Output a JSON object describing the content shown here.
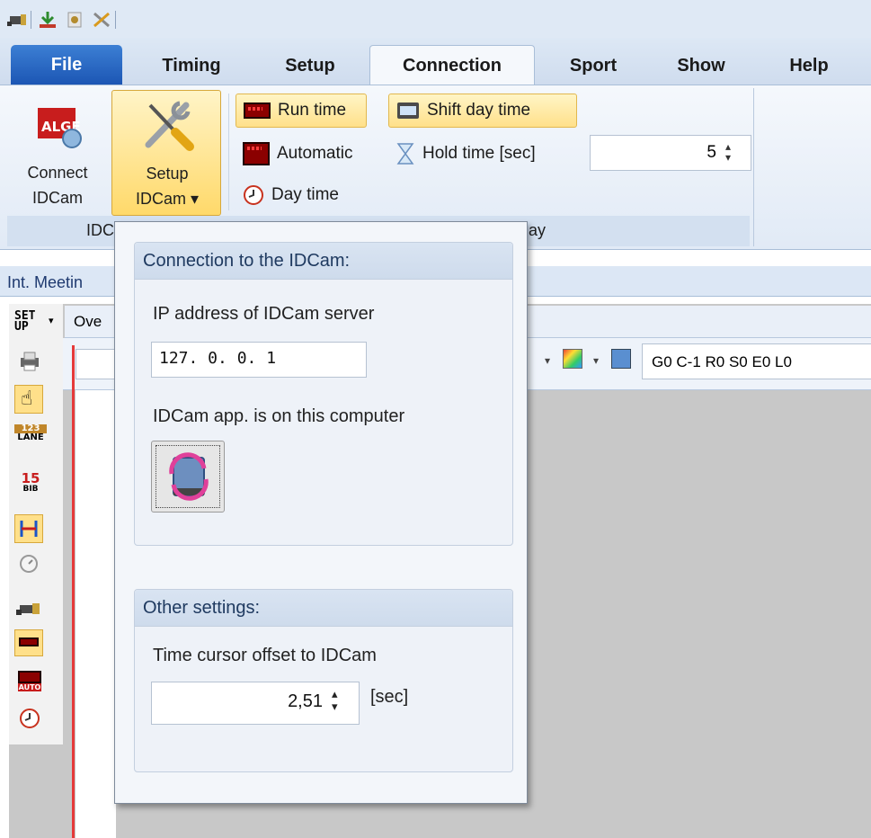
{
  "ribbon_tabs": {
    "file": "File",
    "timing": "Timing",
    "setup": "Setup",
    "connection": "Connection",
    "sport": "Sport",
    "show": "Show",
    "help": "Help"
  },
  "connection_ribbon": {
    "connect_idcam": {
      "line1": "Connect",
      "line2": "IDCam"
    },
    "setup_idcam": {
      "line1": "Setup",
      "line2": "IDCam ▾"
    },
    "run_time": "Run time",
    "automatic": "Automatic",
    "day_time": "Day time",
    "shift_day_time": "Shift day time",
    "hold_time_label": "Hold time [sec]",
    "hold_time_value": "5",
    "group_label_left": "IDC",
    "group_label_right": "ay"
  },
  "workspace": {
    "meeting_tab": "Int. Meetin",
    "setup_tool": "SET UP",
    "overview_tab": "Ove",
    "status_code": "G0 C-1 R0 S0 E0 L0",
    "lane_label": "LANE",
    "lane_number": "123",
    "bib_number": "15",
    "bib_label": "BIB",
    "auto_label": "AUTO"
  },
  "dropdown": {
    "connection_header": "Connection to the IDCam:",
    "ip_label": "IP address of IDCam server",
    "ip_value": "127.  0.  0.  1",
    "local_label": "IDCam app. is on this computer",
    "other_header": "Other settings:",
    "offset_label": "Time cursor offset to IDCam",
    "offset_value": "2,51",
    "offset_unit": "[sec]"
  },
  "colors": {
    "file_tab": "#1c56b4",
    "highlight": "#ffe08a",
    "accent_red": "#e53a3a"
  }
}
